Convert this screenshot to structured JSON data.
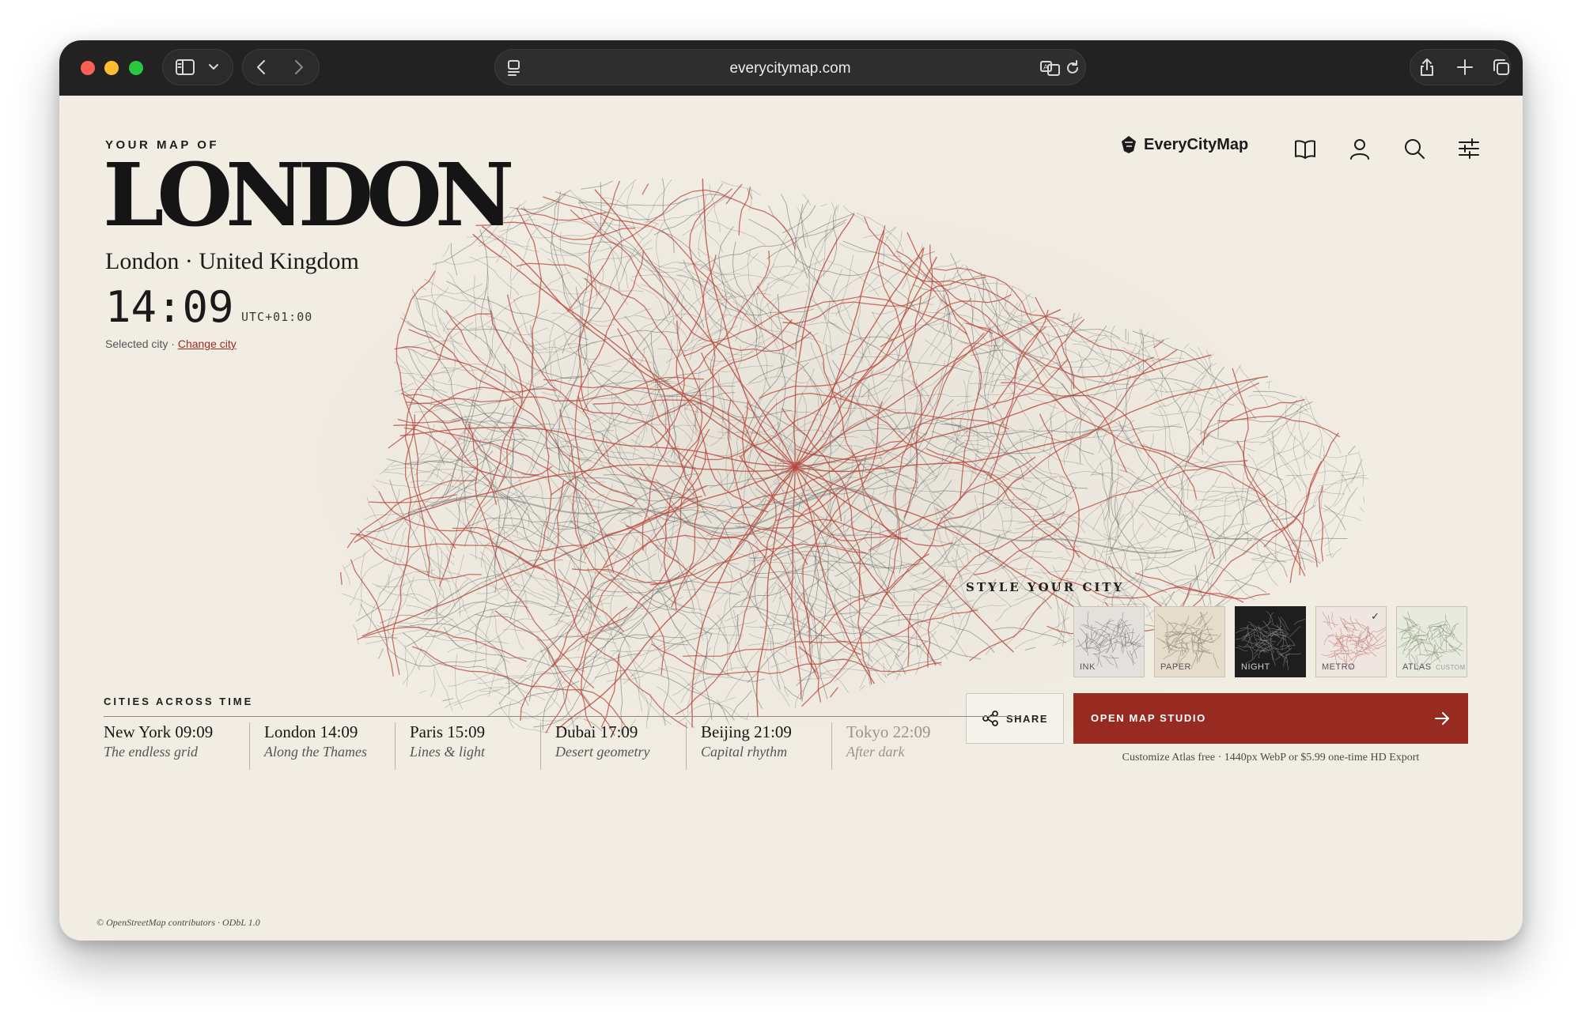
{
  "browser": {
    "url": "everycitymap.com"
  },
  "hero": {
    "eyebrow": "YOUR MAP OF",
    "city": "LONDON",
    "subtitle": "London · United Kingdom",
    "time": "14:09",
    "timezone": "UTC+01:00",
    "selected_label": "Selected city ·",
    "change_city": "Change city"
  },
  "nav": {
    "brand": "EveryCityMap",
    "icons": [
      "book-icon",
      "user-icon",
      "search-icon",
      "sliders-icon"
    ]
  },
  "styles": {
    "heading": "STYLE YOUR CITY",
    "swatches": [
      {
        "label": "INK",
        "bg": "#e4e1dc",
        "line": "#7a7a7a"
      },
      {
        "label": "PAPER",
        "bg": "#e6dccb",
        "line": "#8c8070"
      },
      {
        "label": "NIGHT",
        "bg": "#1e1e1e",
        "line": "#8a8a8a"
      },
      {
        "label": "METRO",
        "bg": "#efe6e2",
        "line": "#c07a72",
        "selected": true
      },
      {
        "label": "ATLAS",
        "extra": "CUSTOM",
        "bg": "#e8eadf",
        "line": "#7f9470"
      }
    ]
  },
  "actions": {
    "share": "SHARE",
    "open": "OPEN MAP STUDIO",
    "note": "Customize Atlas free · 1440px WebP or $5.99 one-time HD Export"
  },
  "cities_across_time": {
    "heading": "CITIES ACROSS TIME",
    "items": [
      {
        "name": "New York 09:09",
        "tag": "The endless grid"
      },
      {
        "name": "London 14:09",
        "tag": "Along the Thames"
      },
      {
        "name": "Paris 15:09",
        "tag": "Lines & light"
      },
      {
        "name": "Dubai 17:09",
        "tag": "Desert geometry"
      },
      {
        "name": "Beijing 21:09",
        "tag": "Capital rhythm"
      },
      {
        "name": "Tokyo 22:09",
        "tag": "After dark"
      }
    ]
  },
  "attribution": "© OpenStreetMap contributors · ODbL 1.0",
  "colors": {
    "accent": "#972b22",
    "background": "#f1ede3",
    "road_major": "#b8463c",
    "road_minor": "#5a5a5a"
  }
}
